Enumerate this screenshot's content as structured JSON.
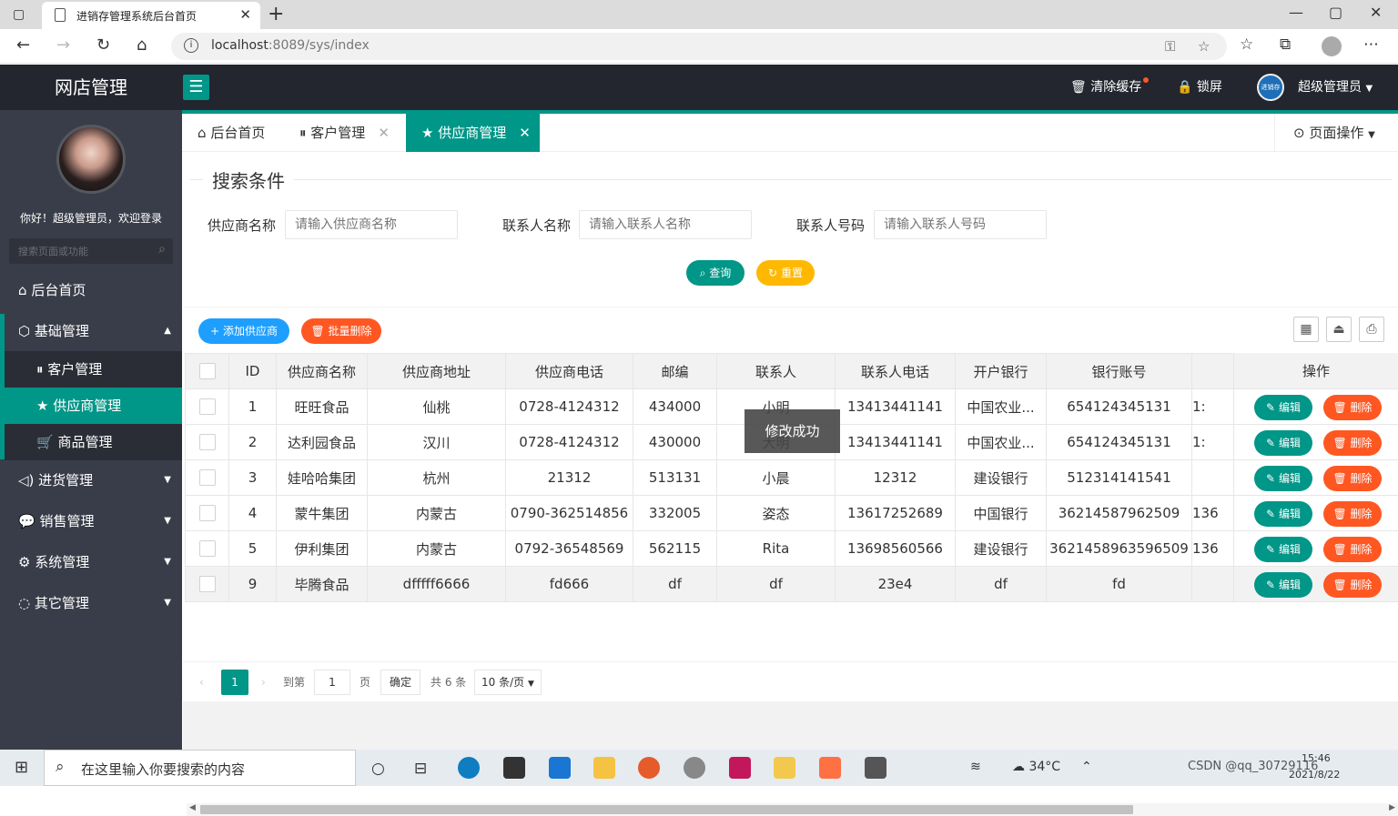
{
  "browser": {
    "tab_title": "进销存管理系统后台首页",
    "url_host": "localhost",
    "url_path": ":8089/sys/index"
  },
  "header": {
    "logo": "网店管理",
    "clear_cache": "清除缓存",
    "lock_screen": "锁屏",
    "user_name": "超级管理员",
    "avatar_text": "进销存"
  },
  "sidebar": {
    "welcome": "你好！超级管理员，欢迎登录",
    "search_placeholder": "搜索页面或功能",
    "items": [
      {
        "label": "后台首页"
      },
      {
        "label": "基础管理"
      },
      {
        "label": "客户管理"
      },
      {
        "label": "供应商管理"
      },
      {
        "label": "商品管理"
      },
      {
        "label": "进货管理"
      },
      {
        "label": "销售管理"
      },
      {
        "label": "系统管理"
      },
      {
        "label": "其它管理"
      }
    ]
  },
  "tabs": {
    "items": [
      {
        "label": "后台首页"
      },
      {
        "label": "客户管理"
      },
      {
        "label": "供应商管理"
      }
    ],
    "page_ops": "页面操作"
  },
  "search": {
    "title": "搜索条件",
    "supplier_label": "供应商名称",
    "supplier_placeholder": "请输入供应商名称",
    "contact_label": "联系人名称",
    "contact_placeholder": "请输入联系人名称",
    "phone_label": "联系人号码",
    "phone_placeholder": "请输入联系人号码",
    "query_btn": "查询",
    "reset_btn": "重置"
  },
  "toolbar": {
    "add_btn": "添加供应商",
    "batch_delete_btn": "批量删除"
  },
  "table": {
    "columns": [
      "ID",
      "供应商名称",
      "供应商地址",
      "供应商电话",
      "邮编",
      "联系人",
      "联系人电话",
      "开户银行",
      "银行账号",
      ""
    ],
    "op_header": "操作",
    "edit_label": "编辑",
    "delete_label": "删除",
    "rows": [
      [
        "1",
        "旺旺食品",
        "仙桃",
        "0728-4124312",
        "434000",
        "小明",
        "13413441141",
        "中国农业...",
        "654124345131",
        "1:"
      ],
      [
        "2",
        "达利园食品",
        "汉川",
        "0728-4124312",
        "430000",
        "大明",
        "13413441141",
        "中国农业...",
        "654124345131",
        "1:"
      ],
      [
        "3",
        "娃哈哈集团",
        "杭州",
        "21312",
        "513131",
        "小晨",
        "12312",
        "建设银行",
        "512314141541",
        ""
      ],
      [
        "4",
        "蒙牛集团",
        "内蒙古",
        "0790-362514856",
        "332005",
        "姿态",
        "13617252689",
        "中国银行",
        "36214587962509",
        "136"
      ],
      [
        "5",
        "伊利集团",
        "内蒙古",
        "0792-36548569",
        "562115",
        "Rita",
        "13698560566",
        "建设银行",
        "3621458963596509",
        "136"
      ],
      [
        "9",
        "毕腾食品",
        "dfffff6666",
        "fd666",
        "df",
        "df",
        "23e4",
        "df",
        "fd",
        ""
      ]
    ]
  },
  "toast": "修改成功",
  "pager": {
    "current": "1",
    "goto_label": "到第",
    "goto_value": "1",
    "page_label": "页",
    "confirm": "确定",
    "total": "共 6 条",
    "page_size": "10 条/页"
  },
  "taskbar": {
    "search_text": "在这里输入你要搜索的内容",
    "temperature": "34°C",
    "time": "15:46",
    "date": "2021/8/22",
    "watermark": "CSDN @qq_30729116"
  },
  "colors": {
    "primary": "#009688",
    "warning": "#ffb800",
    "danger": "#ff5722",
    "normal": "#1e9fff",
    "sidebar": "#393d49",
    "header": "#23262e"
  }
}
